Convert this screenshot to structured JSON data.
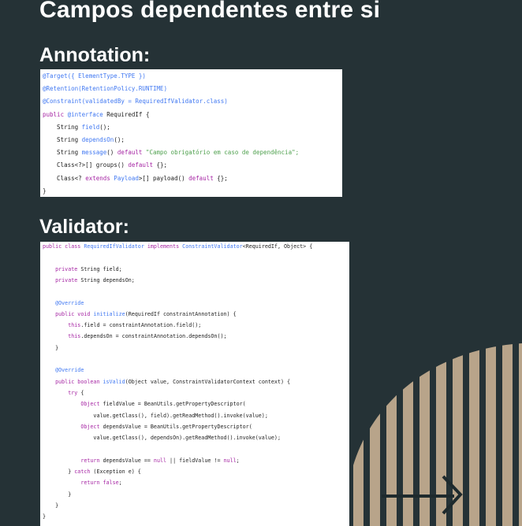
{
  "title": "Campos dependentes entre si",
  "sections": {
    "annotation_label": "Annotation:",
    "validator_label": "Validator:"
  },
  "colors": {
    "background": "#253236",
    "stripes": "#b8a48a",
    "arrow": "#1e2a2d",
    "keyword": "#a626a4",
    "annotation": "#4078f2",
    "string": "#50a14f",
    "text": "#222222"
  },
  "annotation_code": [
    [
      {
        "t": "@Target({ ElementType.TYPE })",
        "c": "ann"
      }
    ],
    [
      {
        "t": "@Retention(RetentionPolicy.RUNTIME)",
        "c": "ann"
      }
    ],
    [
      {
        "t": "@Constraint(validatedBy = RequiredIfValidator.class)",
        "c": "ann"
      }
    ],
    [
      {
        "t": "public ",
        "c": "kw"
      },
      {
        "t": "@interface",
        "c": "ann"
      },
      {
        "t": " RequiredIf {",
        "c": ""
      }
    ],
    [
      {
        "t": "    String ",
        "c": ""
      },
      {
        "t": "field",
        "c": "name"
      },
      {
        "t": "();",
        "c": ""
      }
    ],
    [
      {
        "t": "    String ",
        "c": ""
      },
      {
        "t": "dependsOn",
        "c": "name"
      },
      {
        "t": "();",
        "c": ""
      }
    ],
    [
      {
        "t": "    String ",
        "c": ""
      },
      {
        "t": "message",
        "c": "name"
      },
      {
        "t": "() ",
        "c": ""
      },
      {
        "t": "default",
        "c": "kw"
      },
      {
        "t": " \"Campo obrigatório em caso de dependência\";",
        "c": "str"
      }
    ],
    [
      {
        "t": "    Class<?>[] groups() ",
        "c": ""
      },
      {
        "t": "default",
        "c": "kw"
      },
      {
        "t": " {};",
        "c": ""
      }
    ],
    [
      {
        "t": "    Class<? ",
        "c": ""
      },
      {
        "t": "extends",
        "c": "kw"
      },
      {
        "t": " Payload",
        "c": "name"
      },
      {
        "t": ">[] payload() ",
        "c": ""
      },
      {
        "t": "default",
        "c": "kw"
      },
      {
        "t": " {};",
        "c": ""
      }
    ],
    [
      {
        "t": "}",
        "c": ""
      }
    ]
  ],
  "validator_code": [
    [
      {
        "t": "public class ",
        "c": "kw"
      },
      {
        "t": "RequiredIfValidator",
        "c": "name"
      },
      {
        "t": " implements ",
        "c": "kw"
      },
      {
        "t": "ConstraintValidator",
        "c": "name"
      },
      {
        "t": "<RequiredIf, Object> {",
        "c": ""
      }
    ],
    [],
    [
      {
        "t": "    private ",
        "c": "kw"
      },
      {
        "t": "String field;",
        "c": ""
      }
    ],
    [
      {
        "t": "    private ",
        "c": "kw"
      },
      {
        "t": "String dependsOn;",
        "c": ""
      }
    ],
    [],
    [
      {
        "t": "    @Override",
        "c": "ann"
      }
    ],
    [
      {
        "t": "    public void ",
        "c": "kw"
      },
      {
        "t": "initialize",
        "c": "name"
      },
      {
        "t": "(RequiredIf constraintAnnotation) {",
        "c": ""
      }
    ],
    [
      {
        "t": "        this",
        "c": "kw"
      },
      {
        "t": ".field = constraintAnnotation.field();",
        "c": ""
      }
    ],
    [
      {
        "t": "        this",
        "c": "kw"
      },
      {
        "t": ".dependsOn = constraintAnnotation.dependsOn();",
        "c": ""
      }
    ],
    [
      {
        "t": "    }",
        "c": ""
      }
    ],
    [],
    [
      {
        "t": "    @Override",
        "c": "ann"
      }
    ],
    [
      {
        "t": "    public boolean ",
        "c": "kw"
      },
      {
        "t": "isValid",
        "c": "name"
      },
      {
        "t": "(Object value, ConstraintValidatorContext context) {",
        "c": ""
      }
    ],
    [
      {
        "t": "        try ",
        "c": "kw"
      },
      {
        "t": "{",
        "c": ""
      }
    ],
    [
      {
        "t": "            Object ",
        "c": "kw"
      },
      {
        "t": "fieldValue = BeanUtils.getPropertyDescriptor(",
        "c": ""
      }
    ],
    [
      {
        "t": "                value.getClass(), field).getReadMethod().invoke(value);",
        "c": ""
      }
    ],
    [
      {
        "t": "            Object ",
        "c": "kw"
      },
      {
        "t": "dependsValue = BeanUtils.getPropertyDescriptor(",
        "c": ""
      }
    ],
    [
      {
        "t": "                value.getClass(), dependsOn).getReadMethod().invoke(value);",
        "c": ""
      }
    ],
    [],
    [
      {
        "t": "            return ",
        "c": "kw"
      },
      {
        "t": "dependsValue == ",
        "c": ""
      },
      {
        "t": "null",
        "c": "kw"
      },
      {
        "t": " || fieldValue != ",
        "c": ""
      },
      {
        "t": "null",
        "c": "kw"
      },
      {
        "t": ";",
        "c": ""
      }
    ],
    [
      {
        "t": "        } ",
        "c": ""
      },
      {
        "t": "catch",
        "c": "kw"
      },
      {
        "t": " (Exception e) {",
        "c": ""
      }
    ],
    [
      {
        "t": "            return false",
        "c": "kw"
      },
      {
        "t": ";",
        "c": ""
      }
    ],
    [
      {
        "t": "        }",
        "c": ""
      }
    ],
    [
      {
        "t": "    }",
        "c": ""
      }
    ],
    [
      {
        "t": "}",
        "c": ""
      }
    ]
  ]
}
